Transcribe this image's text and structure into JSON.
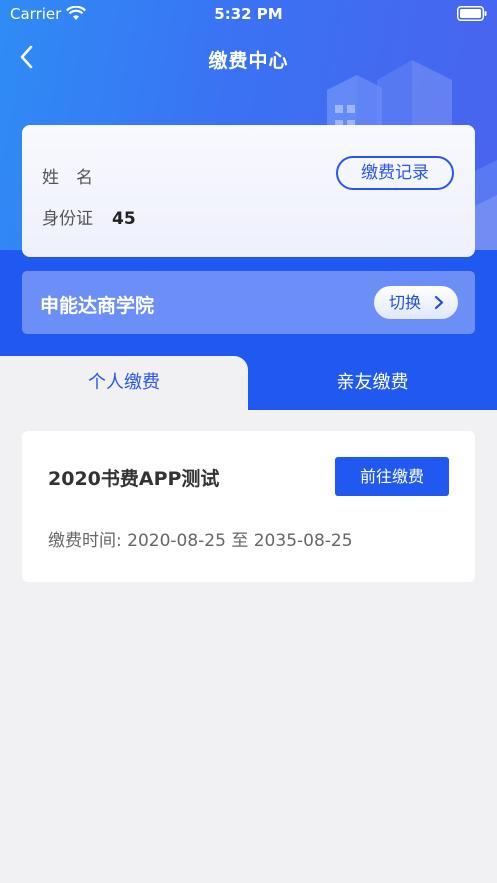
{
  "status_bar": {
    "carrier": "Carrier",
    "time": "5:32 PM"
  },
  "navbar": {
    "title": "缴费中心",
    "back_icon": "chevron-left-icon"
  },
  "user_info": {
    "name_label": "姓　名",
    "name_value": "",
    "id_label": "身份证",
    "id_value": "45",
    "record_button": "缴费记录"
  },
  "school": {
    "name": "申能达商学院",
    "switch_label": "切换"
  },
  "tabs": [
    {
      "label": "个人缴费",
      "active": true
    },
    {
      "label": "亲友缴费",
      "active": false
    }
  ],
  "payments": [
    {
      "title": "2020书费APP测试",
      "action": "前往缴费",
      "time_label": "缴费时间:",
      "time_range": "2020-08-25 至 2035-08-25"
    }
  ],
  "colors": {
    "primary": "#1f59f0",
    "accent": "#2a56e8",
    "background": "#f1f1f3"
  }
}
